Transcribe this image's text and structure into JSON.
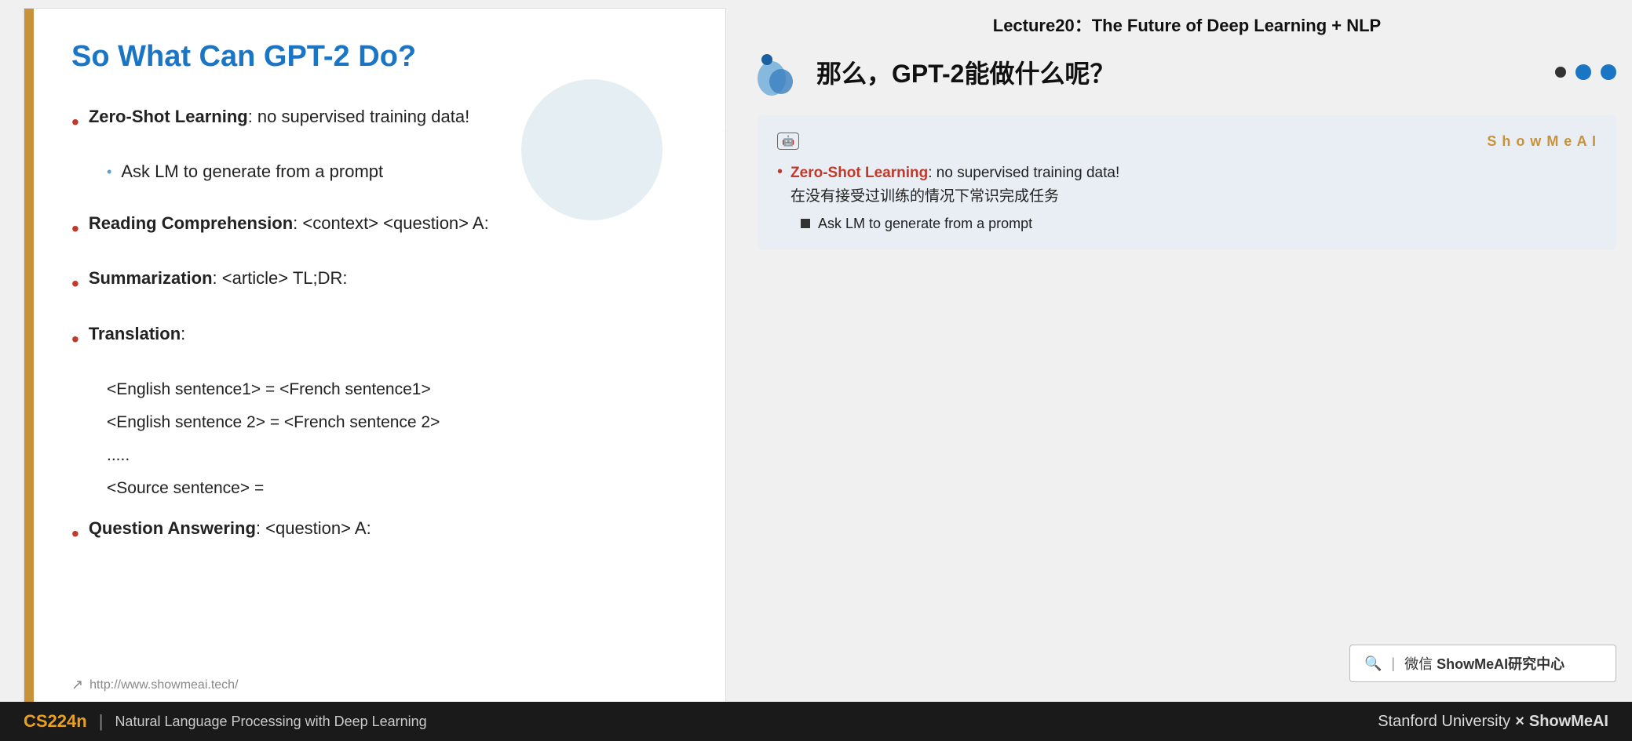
{
  "lecture": {
    "title": "Lecture20：The Future of Deep Learning + NLP"
  },
  "left_slide": {
    "title": "So What Can GPT-2 Do?",
    "bullets": [
      {
        "label": "Zero-Shot Learning",
        "text": ": no supervised training data!",
        "sub": [
          "Ask LM to generate from a prompt"
        ]
      },
      {
        "label": "Reading Comprehension",
        "text": ": <context> <question> A:",
        "sub": []
      },
      {
        "label": "Summarization",
        "text": ": <article> TL;DR:",
        "sub": []
      },
      {
        "label": "Translation",
        "text": ":",
        "sub": []
      }
    ],
    "translation_lines": [
      "<English sentence1> = <French sentence1>",
      "<English sentence 2> = <French sentence 2>",
      ".....",
      "<Source sentence> ="
    ],
    "last_bullet": {
      "label": "Question Answering",
      "text": ": <question> A:"
    },
    "footer_url": "http://www.showmeai.tech/"
  },
  "right_panel": {
    "header_title": "那么，GPT-2能做什么呢？",
    "card": {
      "ai_badge": "🤖",
      "showmeai_label": "S h o w M e A I",
      "bullet_label": "Zero-Shot Learning",
      "bullet_text": ": no supervised training data!",
      "bullet_chinese": "在没有接受过训练的情况下常识完成任务",
      "sub_text": "Ask LM to generate from a prompt"
    },
    "search_box": {
      "icon": "🔍",
      "text": "搜索 | 微信 ShowMeAI研究中心"
    }
  },
  "bottom_bar": {
    "cs224n": "CS224n",
    "divider": "|",
    "subtitle": "Natural Language Processing with Deep Learning",
    "right": "Stanford University  ×  ShowMeAI"
  }
}
